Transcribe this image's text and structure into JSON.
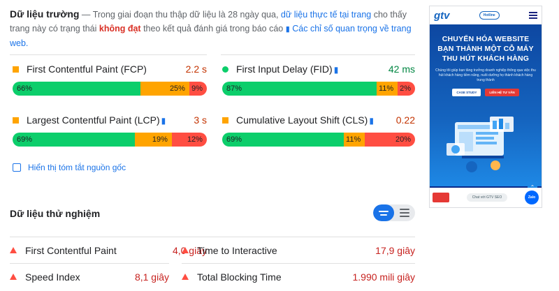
{
  "field": {
    "title": "Dữ liệu trường",
    "dash": " — ",
    "desc1": "Trong giai đoạn thu thập dữ liệu là 28 ngày qua,",
    "link1": "dữ liệu thực tế tại trang",
    "desc2": "cho thấy trang này có trạng thái",
    "status": "không đạt",
    "desc3": "theo kết quả đánh giá trong báo cáo",
    "link2": "Các chỉ số quan trọng về trang web.",
    "metrics": [
      {
        "name": "First Contentful Paint (FCP)",
        "value": "2.2 s",
        "bar": [
          "66%",
          "25%",
          "9%"
        ],
        "fractions": [
          0.66,
          0.25,
          0.09
        ]
      },
      {
        "name": "First Input Delay (FID)",
        "value": "42 ms",
        "bar": [
          "87%",
          "11%",
          "2%"
        ],
        "fractions": [
          0.87,
          0.11,
          0.02
        ]
      },
      {
        "name": "Largest Contentful Paint (LCP)",
        "value": "3 s",
        "bar": [
          "69%",
          "19%",
          "12%"
        ],
        "fractions": [
          0.69,
          0.19,
          0.12
        ]
      },
      {
        "name": "Cumulative Layout Shift (CLS)",
        "value": "0.22",
        "bar": [
          "69%",
          "11%",
          "20%"
        ],
        "fractions": [
          0.69,
          0.11,
          0.2
        ]
      }
    ],
    "origin_label": "Hiển thị tóm tắt nguồn gốc"
  },
  "lab": {
    "title": "Dữ liệu thử nghiệm",
    "metrics": [
      {
        "name": "First Contentful Paint",
        "value": "4,0 giây"
      },
      {
        "name": "Time to Interactive",
        "value": "17,9 giây"
      },
      {
        "name": "Speed Index",
        "value": "8,1 giây"
      },
      {
        "name": "Total Blocking Time",
        "value": "1.990 mili giây"
      }
    ]
  },
  "preview": {
    "logo": "gtv",
    "hotline": "Hotline",
    "headline": "CHUYỂN HÓA WEBSITE BẠN THÀNH MỘT CỖ MÁY THU HÚT KHÁCH HÀNG",
    "subtext": "Chúng tôi giúp bạn tăng trưởng doanh nghiệp thông qua việc thu hút khách hàng tiềm năng, nuôi dưỡng họ thành khách hàng trung thành",
    "btn1": "CASE STUDY",
    "btn2": "LIÊN HỆ TƯ VẤN",
    "chat": "Chat với GTV SEO",
    "zalo": "Zalo"
  },
  "colors": {
    "green": "#0cce6b",
    "orange": "#ffa400",
    "red": "#ff4e42",
    "link": "#1a73e8"
  }
}
